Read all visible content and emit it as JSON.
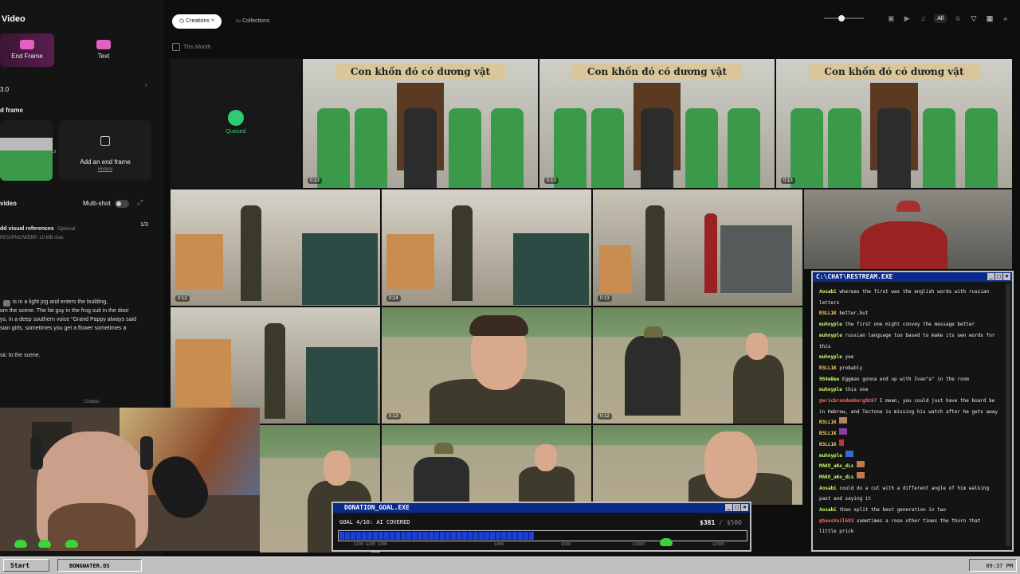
{
  "left_panel": {
    "header": "Video",
    "modes": [
      "End Frame",
      "Text"
    ],
    "model_version": "3.0",
    "end_frame_label": "d frame",
    "add_end_frame": "Add an end frame",
    "history": "History",
    "video_label": "video",
    "multishot": "Multi-shot",
    "visual_refs": "dd visual references",
    "optional": "Optional",
    "formats": "PEG/PNG/WEBP. 10 MB max",
    "ref_count": "1/3",
    "prompt_lines": [
      "is in a light jog and enters the building,",
      "om the scene. The fat guy in the frog suit in the door",
      "ys, in a deep southern voice \"Grand Pappy always said",
      "sian girls, sometimes you get a flower sometimes a",
      "sic to the scene."
    ],
    "output_label": "Output"
  },
  "topbar": {
    "tab_creations": "Creations",
    "tab_collections": "Collections",
    "all_label": "All",
    "month_filter": "This Month"
  },
  "grid": {
    "queued_label": "Queued",
    "sign_text": "Con khốn đó có dương vật",
    "durations": [
      "0:13",
      "0:13",
      "0:13",
      "0:12",
      "0:14",
      "0:13",
      "0:13",
      "0:12"
    ]
  },
  "chat": {
    "title": "C:\\CHAT\\RESTREAM.EXE",
    "messages": [
      {
        "user": "Aosabi",
        "text": "whereas the first was the english words with russian"
      },
      {
        "user": "",
        "text": "letters"
      },
      {
        "user": "R3LL1K",
        "text": "better,but"
      },
      {
        "user": "muhnyple",
        "text": "the first one might convey the message better"
      },
      {
        "user": "muhnyple",
        "text": "russian language too based to make its own words for"
      },
      {
        "user": "",
        "text": "this"
      },
      {
        "user": "muhnyple",
        "text": "yee"
      },
      {
        "user": "R3LL1K",
        "text": "probably"
      },
      {
        "user": "984eBee",
        "text": "Eggman gonna end up with Ivan\"a\" in the room"
      },
      {
        "user": "muhnyple",
        "text": "this one"
      },
      {
        "user": "@ericbrandenburg9267",
        "text": "I mean, you could just have the board be"
      },
      {
        "user": "",
        "text": "in Hebrew, and Tectone is missing his watch after he gets away"
      },
      {
        "user": "R3LL1K",
        "text": ""
      },
      {
        "user": "R3LL1K",
        "text": ""
      },
      {
        "user": "R3LL1K",
        "text": ""
      },
      {
        "user": "muhnyple",
        "text": ""
      },
      {
        "user": "MAKO_aKo_dLs",
        "text": ""
      },
      {
        "user": "MAKO_aKo_dLs",
        "text": ""
      },
      {
        "user": "Aosabi",
        "text": "could do a cut with a different angle of him walking"
      },
      {
        "user": "",
        "text": "past and saying it"
      },
      {
        "user": "Aosabi",
        "text": "then split the best generation in two"
      },
      {
        "user": "@GeusVuil683",
        "text": "sometimes a rose other times the thorn that"
      },
      {
        "user": "",
        "text": "little prick"
      }
    ]
  },
  "donation": {
    "title": "DONATION_GOAL.EXE",
    "goal_text": "GOAL 4/10: AI COVERED",
    "amount": "$381",
    "target": "/ $500",
    "progress": 0.48,
    "ticks": [
      "$100 $200 $300",
      "$400",
      "$500",
      "$1000",
      "$2000"
    ]
  },
  "taskbar": {
    "start": "Start",
    "task": "BONGWATER.OS",
    "clock": "09:37 PM"
  }
}
